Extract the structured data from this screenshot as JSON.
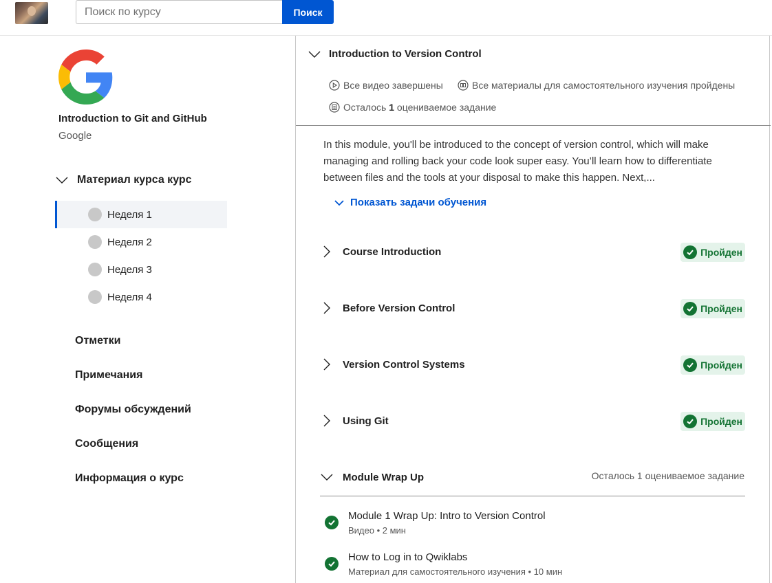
{
  "search": {
    "placeholder": "Поиск по курсу",
    "button": "Поиск"
  },
  "sidebar": {
    "course_title": "Introduction to Git and GitHub",
    "course_org": "Google",
    "material_heading": "Материал курса курс",
    "weeks": [
      "Неделя 1",
      "Неделя 2",
      "Неделя 3",
      "Неделя 4"
    ],
    "links": [
      "Отметки",
      "Примечания",
      "Форумы обсуждений",
      "Сообщения",
      "Информация о курс"
    ]
  },
  "module": {
    "title": "Introduction to Version Control",
    "stats": {
      "videos": "Все видео завершены",
      "materials": "Все материалы для самостоятельного изучения пройдены",
      "remaining_prefix": "Осталось",
      "remaining_count": "1",
      "remaining_suffix": "оцениваемое задание"
    },
    "description": "In this module, you'll be introduced to the concept of version control, which will make managing and rolling back your code look super easy. You’ll learn how to differentiate between files and the tools at your disposal to make this happen. Next,...",
    "show_goals": "Показать задачи обучения",
    "lessons": [
      {
        "title": "Course Introduction",
        "status": "Пройден"
      },
      {
        "title": "Before Version Control",
        "status": "Пройден"
      },
      {
        "title": "Version Control Systems",
        "status": "Пройден"
      },
      {
        "title": "Using Git",
        "status": "Пройден"
      }
    ],
    "wrap_up": {
      "title": "Module Wrap Up",
      "remaining": "Осталось 1 оцениваемое задание",
      "items": [
        {
          "title": "Module 1 Wrap Up: Intro to Version Control",
          "meta": "Видео • 2 мин"
        },
        {
          "title": "How to Log in to Qwiklabs",
          "meta": "Материал для самостоятельного изучения • 10 мин"
        }
      ]
    }
  },
  "colors": {
    "accent": "#0056d2",
    "success": "#137333",
    "success_bg": "#e4f3ea"
  }
}
